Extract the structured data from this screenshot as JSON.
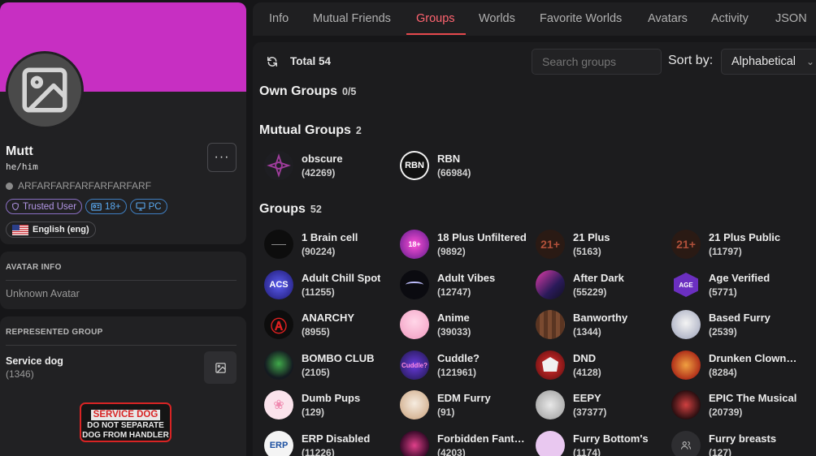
{
  "profile": {
    "name": "Mutt",
    "pronouns": "he/him",
    "status_text": "ARFARFARFARFARFARFARF",
    "badges": {
      "trusted": "Trusted User",
      "age": "18+",
      "platform": "PC"
    },
    "language": "English (eng)",
    "more_label": "···"
  },
  "avatar_info": {
    "label": "AVATAR INFO",
    "value": "Unknown Avatar"
  },
  "represented_group": {
    "label": "REPRESENTED GROUP",
    "name": "Service dog",
    "count": "(1346)",
    "patch": {
      "top": "SERVICE DOG",
      "line1": "DO NOT SEPARATE",
      "line2": "DOG FROM HANDLER"
    }
  },
  "tabs": [
    "Info",
    "Mutual Friends",
    "Groups",
    "Worlds",
    "Favorite Worlds",
    "Avatars",
    "Activity",
    "JSON"
  ],
  "toolbar": {
    "total": "Total 54",
    "search_placeholder": "Search groups",
    "sort_label": "Sort by:",
    "sort_value": "Alphabetical"
  },
  "sections": {
    "own": {
      "title": "Own Groups",
      "count": "0/5"
    },
    "mutual": {
      "title": "Mutual Groups",
      "count": "2"
    },
    "groups": {
      "title": "Groups",
      "count": "52"
    }
  },
  "mutual_groups": [
    {
      "name": "obscure",
      "count": "(42269)"
    },
    {
      "name": "RBN",
      "count": "(66984)"
    }
  ],
  "groups": [
    {
      "name": "1 Brain cell",
      "count": "(90224)"
    },
    {
      "name": "18 Plus Unfiltered",
      "count": "(9892)"
    },
    {
      "name": "21 Plus",
      "count": "(5163)"
    },
    {
      "name": "21 Plus Public",
      "count": "(11797)"
    },
    {
      "name": "Adult Chill Spot",
      "count": "(11255)"
    },
    {
      "name": "Adult Vibes",
      "count": "(12747)"
    },
    {
      "name": "After Dark",
      "count": "(55229)"
    },
    {
      "name": "Age Verified",
      "count": "(5771)"
    },
    {
      "name": "ANARCHY",
      "count": "(8955)"
    },
    {
      "name": "Anime",
      "count": "(39033)"
    },
    {
      "name": "Banworthy",
      "count": "(1344)"
    },
    {
      "name": "Based Furry",
      "count": "(2539)"
    },
    {
      "name": "BOMBO CLUB",
      "count": "(2105)"
    },
    {
      "name": "Cuddle?",
      "count": "(121961)"
    },
    {
      "name": "DND",
      "count": "(4128)"
    },
    {
      "name": "Drunken Clown…",
      "count": "(8284)"
    },
    {
      "name": "Dumb Pups",
      "count": "(129)"
    },
    {
      "name": "EDM Furry",
      "count": "(91)"
    },
    {
      "name": "EEPY",
      "count": "(37377)"
    },
    {
      "name": "EPIC The Musical",
      "count": "(20739)"
    },
    {
      "name": "ERP Disabled",
      "count": "(11226)"
    },
    {
      "name": "Forbidden Fant…",
      "count": "(4203)"
    },
    {
      "name": "Furry Bottom's",
      "count": "(1174)"
    },
    {
      "name": "Furry breasts",
      "count": "(127)"
    }
  ],
  "icon_text": {
    "rbn": "RBN",
    "u18": "18+",
    "p21": "21+",
    "acs": "ACS",
    "age": "AGE",
    "erp": "ERP"
  },
  "colors": {
    "banner": "#c72fc2",
    "active_tab": "#ff6470",
    "accent": "#e5484d"
  }
}
